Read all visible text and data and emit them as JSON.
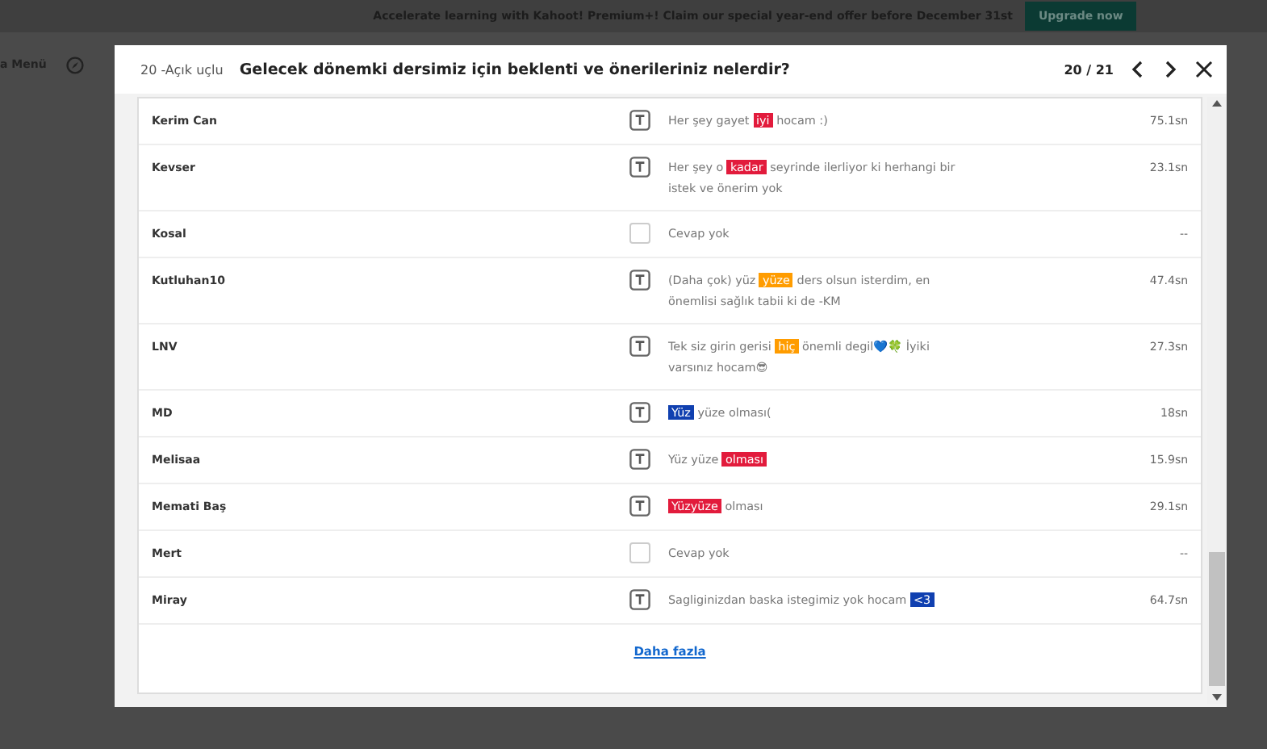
{
  "banner": {
    "text": "Accelerate learning with Kahoot! Premium+! Claim our special year-end offer before December 31st",
    "button": "Upgrade now"
  },
  "page_nav": {
    "menu": "a Menü"
  },
  "dialog": {
    "question_number": "20 -Açık uçlu",
    "question": "Gelecek dönemki dersimiz için beklenti ve önerileriniz nelerdir?",
    "counter": "20 / 21",
    "more_link": "Daha fazla"
  },
  "answers": [
    {
      "name": "Kerim Can",
      "kind": "text",
      "answer": [
        {
          "text": "Her şey gayet "
        },
        {
          "text": "iyi",
          "color": "#e21b3c"
        },
        {
          "text": " hocam :)"
        }
      ],
      "time": "75.1sn"
    },
    {
      "name": "Kevser",
      "kind": "text",
      "answer": [
        {
          "text": "Her şey o "
        },
        {
          "text": "kadar",
          "color": "#e21b3c"
        },
        {
          "text": " seyrinde ilerliyor ki herhangi bir istek ve önerim yok"
        }
      ],
      "time": "23.1sn"
    },
    {
      "name": "Kosal",
      "kind": "none",
      "answer": [
        {
          "text": "Cevap yok"
        }
      ],
      "time": "--"
    },
    {
      "name": "Kutluhan10",
      "kind": "text",
      "answer": [
        {
          "text": "(Daha çok) yüz "
        },
        {
          "text": "yüze",
          "color": "#ff9c00"
        },
        {
          "text": " ders olsun isterdim, en önemlisi sağlık tabii ki de -KM"
        }
      ],
      "time": "47.4sn"
    },
    {
      "name": "LNV",
      "kind": "text",
      "answer": [
        {
          "text": "Tek siz girin gerisi "
        },
        {
          "text": "hiç",
          "color": "#ff9c00"
        },
        {
          "text": " önemli degil💙🍀 İyiki varsınız hocam😎"
        }
      ],
      "time": "27.3sn"
    },
    {
      "name": "MD",
      "kind": "text",
      "answer": [
        {
          "text": "Yüz",
          "color": "#1040b0"
        },
        {
          "text": " yüze olması("
        }
      ],
      "time": "18sn"
    },
    {
      "name": "Melisaa",
      "kind": "text",
      "answer": [
        {
          "text": "Yüz yüze "
        },
        {
          "text": "olması",
          "color": "#e21b3c"
        }
      ],
      "time": "15.9sn"
    },
    {
      "name": "Memati Baş",
      "kind": "text",
      "answer": [
        {
          "text": "Yüzyüze",
          "color": "#e21b3c"
        },
        {
          "text": " olması"
        }
      ],
      "time": "29.1sn"
    },
    {
      "name": "Mert",
      "kind": "none",
      "answer": [
        {
          "text": "Cevap yok"
        }
      ],
      "time": "--"
    },
    {
      "name": "Miray",
      "kind": "text",
      "answer": [
        {
          "text": "Sagliginizdan baska istegimiz yok hocam "
        },
        {
          "text": "<3",
          "color": "#1040b0"
        }
      ],
      "time": "64.7sn"
    }
  ]
}
